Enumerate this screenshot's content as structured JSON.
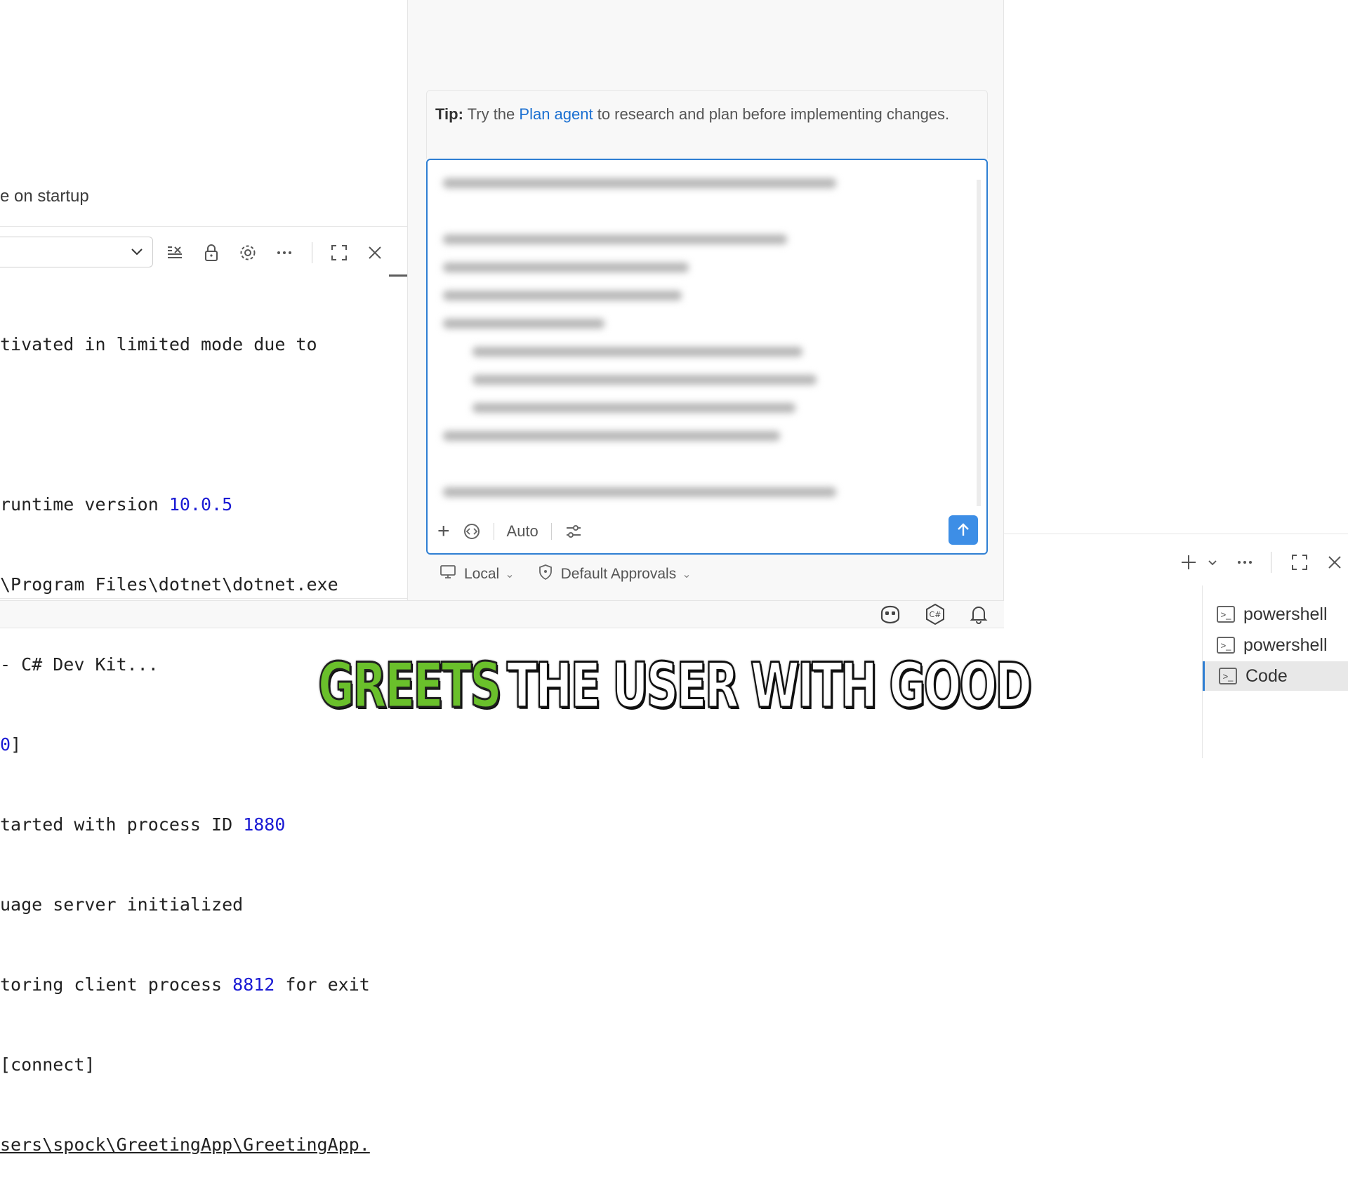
{
  "output_panel": {
    "startup_text": "e on startup",
    "log_lines": [
      {
        "pre": "tivated in limited mode due to",
        "num": "",
        "post": ""
      },
      {
        "pre": "",
        "num": "",
        "post": ""
      },
      {
        "pre": "runtime version ",
        "num": "10.0.5",
        "post": ""
      },
      {
        "pre": "\\Program Files\\dotnet\\dotnet.exe",
        "num": "",
        "post": ""
      },
      {
        "pre": "- C# Dev Kit...",
        "num": "",
        "post": ""
      },
      {
        "pre": "",
        "num": "0",
        "post": "]"
      },
      {
        "pre": "tarted with process ID ",
        "num": "1880",
        "post": ""
      },
      {
        "pre": "uage server initialized",
        "num": "",
        "post": ""
      },
      {
        "pre": "toring client process ",
        "num": "8812",
        "post": " for exit"
      },
      {
        "pre": "[connect]",
        "num": "",
        "post": ""
      },
      {
        "pre": "sers\\spock\\GreetingApp\\GreetingApp.",
        "num": "",
        "post": "",
        "link": true
      }
    ],
    "toolbar_icons": [
      "clear-output-icon",
      "lock-icon",
      "gear-icon",
      "more-icon",
      "maximize-icon",
      "close-icon"
    ]
  },
  "chat": {
    "tip_label": "Tip:",
    "tip_pre": " Try the ",
    "tip_link": "Plan agent",
    "tip_post": " to research and plan before implementing changes.",
    "toolbar": {
      "add_icon": "+",
      "mode_label": "Auto"
    },
    "footer": {
      "location": "Local",
      "approvals": "Default Approvals"
    }
  },
  "terminal": {
    "items": [
      {
        "label": "powershell",
        "active": false
      },
      {
        "label": "powershell",
        "active": false
      },
      {
        "label": "Code",
        "active": true
      }
    ]
  },
  "caption": {
    "highlight": "GREETS",
    "rest": "THE USER WITH GOOD",
    "highlight_color": "#6ac02b"
  },
  "colors": {
    "accent": "#2f7fd3",
    "send_button": "#3d8ee6",
    "link": "#1a6fd1",
    "log_number": "#1a1ad4"
  }
}
